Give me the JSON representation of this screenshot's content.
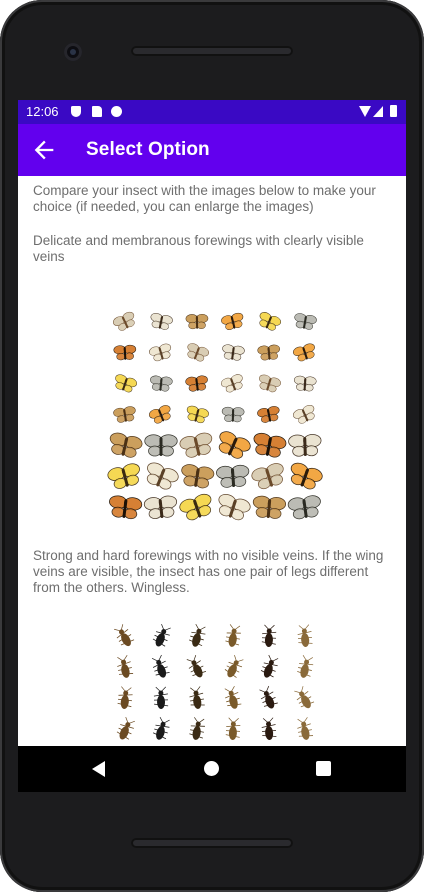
{
  "status_bar": {
    "time": "12:06",
    "icons": [
      "shield-icon",
      "sd-card-icon",
      "data-saver-icon",
      "wifi-icon",
      "cell-signal-icon",
      "battery-icon"
    ]
  },
  "app_bar": {
    "title": "Select Option",
    "back_icon": "arrow-back-icon",
    "color": "#6200ee",
    "status_color": "#3a09c4"
  },
  "content": {
    "intro": "Compare your insect with the images below to make your choice (if needed, you can enlarge the images)",
    "options": [
      {
        "text": "Delicate and membranous forewings with clearly visible veins",
        "image_icon": "winged-insects-grid-image"
      },
      {
        "text": "Strong and hard forewings with no visible veins. If the wing veins are visible, the insect has one pair of legs different from the others. Wingless.",
        "image_icon": "beetles-bugs-grid-image"
      }
    ]
  },
  "nav_bar": {
    "icons": [
      "nav-back-icon",
      "nav-home-icon",
      "nav-recents-icon"
    ]
  }
}
